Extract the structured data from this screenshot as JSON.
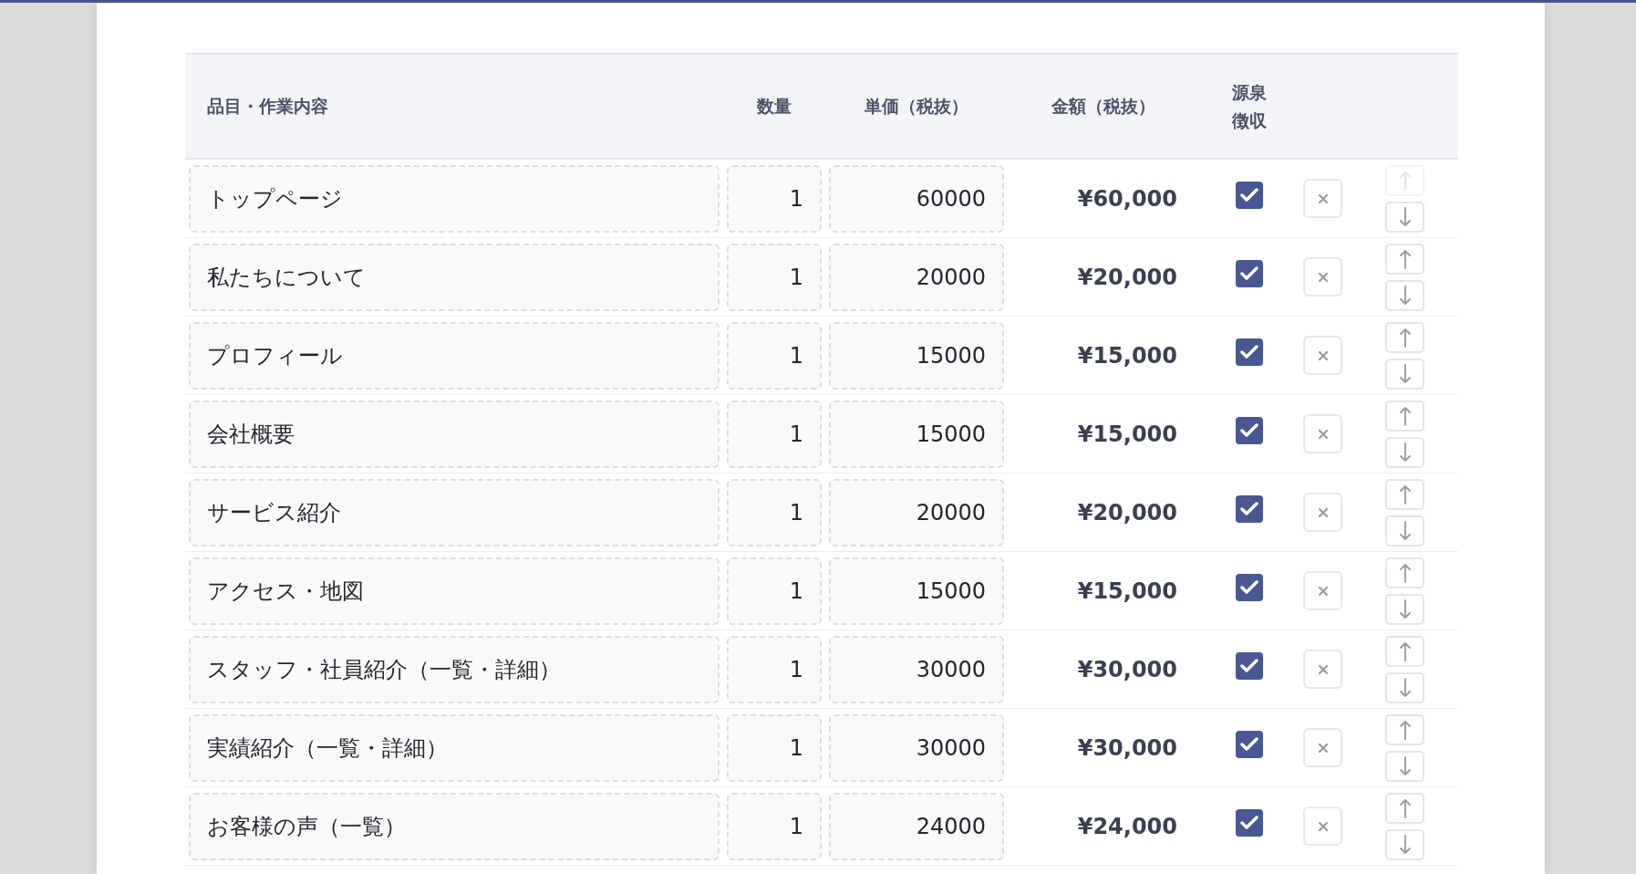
{
  "table": {
    "columns": [
      "品目・作業内容",
      "数量",
      "単価（税抜）",
      "金額（税抜）",
      "源泉徴収"
    ],
    "rows": [
      {
        "item": "トップページ",
        "quantity": "1",
        "unit_price": "60000",
        "amount": "¥60,000",
        "withholding": true,
        "move_up_disabled": true
      },
      {
        "item": "私たちについて",
        "quantity": "1",
        "unit_price": "20000",
        "amount": "¥20,000",
        "withholding": true,
        "move_up_disabled": false
      },
      {
        "item": "プロフィール",
        "quantity": "1",
        "unit_price": "15000",
        "amount": "¥15,000",
        "withholding": true,
        "move_up_disabled": false
      },
      {
        "item": "会社概要",
        "quantity": "1",
        "unit_price": "15000",
        "amount": "¥15,000",
        "withholding": true,
        "move_up_disabled": false
      },
      {
        "item": "サービス紹介",
        "quantity": "1",
        "unit_price": "20000",
        "amount": "¥20,000",
        "withholding": true,
        "move_up_disabled": false
      },
      {
        "item": "アクセス・地図",
        "quantity": "1",
        "unit_price": "15000",
        "amount": "¥15,000",
        "withholding": true,
        "move_up_disabled": false
      },
      {
        "item": "スタッフ・社員紹介（一覧・詳細）",
        "quantity": "1",
        "unit_price": "30000",
        "amount": "¥30,000",
        "withholding": true,
        "move_up_disabled": false
      },
      {
        "item": "実績紹介（一覧・詳細）",
        "quantity": "1",
        "unit_price": "30000",
        "amount": "¥30,000",
        "withholding": true,
        "move_up_disabled": false
      },
      {
        "item": "お客様の声（一覧）",
        "quantity": "1",
        "unit_price": "24000",
        "amount": "¥24,000",
        "withholding": true,
        "move_up_disabled": false
      }
    ]
  }
}
